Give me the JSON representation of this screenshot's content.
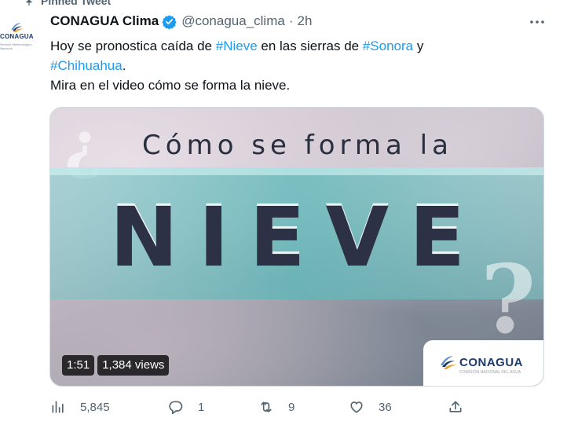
{
  "pinned": {
    "label": "Pinned Tweet"
  },
  "avatar": {
    "logo_text": "CONAGUA",
    "logo_sub": "Servicio Meteorológico Nacional"
  },
  "tweet": {
    "author_name": "CONAGUA Clima",
    "handle": "@conagua_clima",
    "separator": "·",
    "time": "2h",
    "line1_a": "Hoy se pronostica caída de ",
    "hashtag1": "#Nieve",
    "line1_b": " en las sierras de ",
    "hashtag2": "#Sonora",
    "line1_c": " y",
    "hashtag3": "#Chihuahua",
    "line2_a": ".",
    "line3": "Mira en el video cómo se forma la nieve."
  },
  "media": {
    "title_small": "Cómo se forma la",
    "title_big": "NIEVE",
    "q_open": "¿",
    "q_close": "?",
    "duration": "1:51",
    "views": "1,384 views",
    "brand_name": "CONAGUA",
    "brand_sub": "COMISIÓN NACIONAL DEL AGUA"
  },
  "actions": {
    "views": "5,845",
    "replies": "1",
    "retweets": "9",
    "likes": "36"
  },
  "colors": {
    "accent": "#1d9bf0",
    "muted": "#536471",
    "text": "#0f1419"
  },
  "icons": [
    "pin-icon",
    "verified-icon",
    "more-icon",
    "views-icon",
    "reply-icon",
    "retweet-icon",
    "like-icon",
    "share-icon"
  ]
}
